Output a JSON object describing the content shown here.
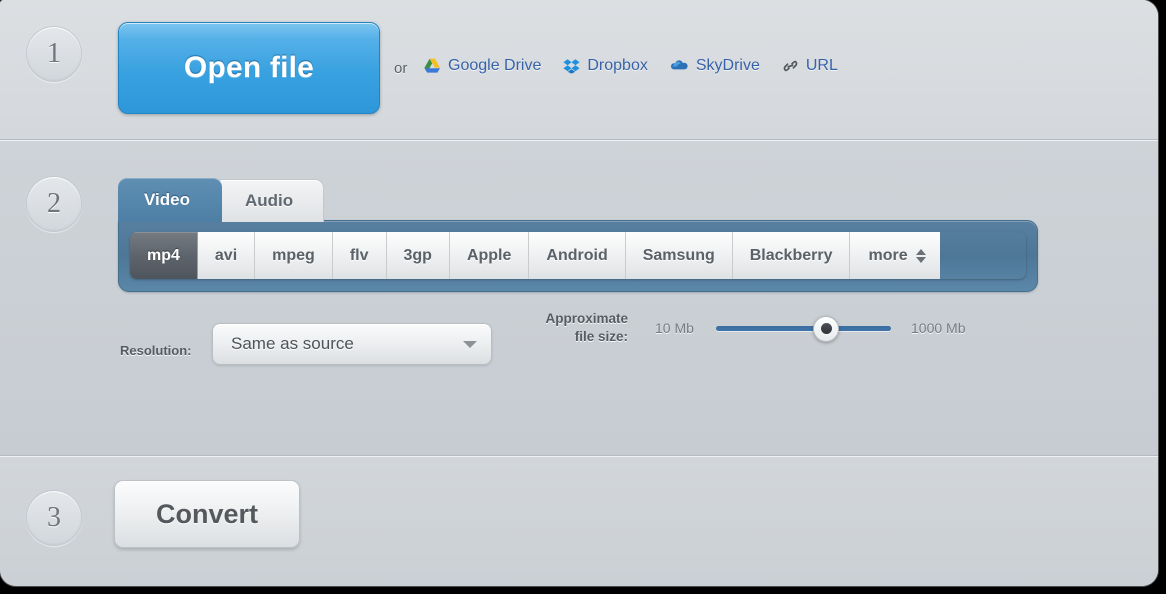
{
  "steps": {
    "one": "1",
    "two": "2",
    "three": "3"
  },
  "step1": {
    "open_file_label": "Open file",
    "or_label": "or",
    "cloud_links": [
      {
        "label": "Google Drive",
        "icon": "google-drive-icon"
      },
      {
        "label": "Dropbox",
        "icon": "dropbox-icon"
      },
      {
        "label": "SkyDrive",
        "icon": "skydrive-icon"
      },
      {
        "label": "URL",
        "icon": "link-icon"
      }
    ],
    "link_color": "#3663a8",
    "button_color": "#38a1e0"
  },
  "step2": {
    "tabs": [
      {
        "label": "Video",
        "active": true
      },
      {
        "label": "Audio",
        "active": false
      }
    ],
    "formats": [
      {
        "label": "mp4",
        "active": true
      },
      {
        "label": "avi",
        "active": false
      },
      {
        "label": "mpeg",
        "active": false
      },
      {
        "label": "flv",
        "active": false
      },
      {
        "label": "3gp",
        "active": false
      },
      {
        "label": "Apple",
        "active": false
      },
      {
        "label": "Android",
        "active": false
      },
      {
        "label": "Samsung",
        "active": false
      },
      {
        "label": "Blackberry",
        "active": false
      },
      {
        "label": "more",
        "active": false
      }
    ],
    "resolution": {
      "label": "Resolution:",
      "value": "Same as source",
      "options": [
        "Same as source"
      ]
    },
    "filesize": {
      "label_line1": "Approximate",
      "label_line2": "file size:",
      "min_label": "10 Mb",
      "max_label": "1000 Mb",
      "value_label": "700 Mb",
      "min": 10,
      "max": 1000,
      "value": 700,
      "track_color": "#3f74a8"
    },
    "tab_active_color": "#4d7fa5",
    "format_bar_color": "#4e7797"
  },
  "step3": {
    "convert_label": "Convert"
  }
}
